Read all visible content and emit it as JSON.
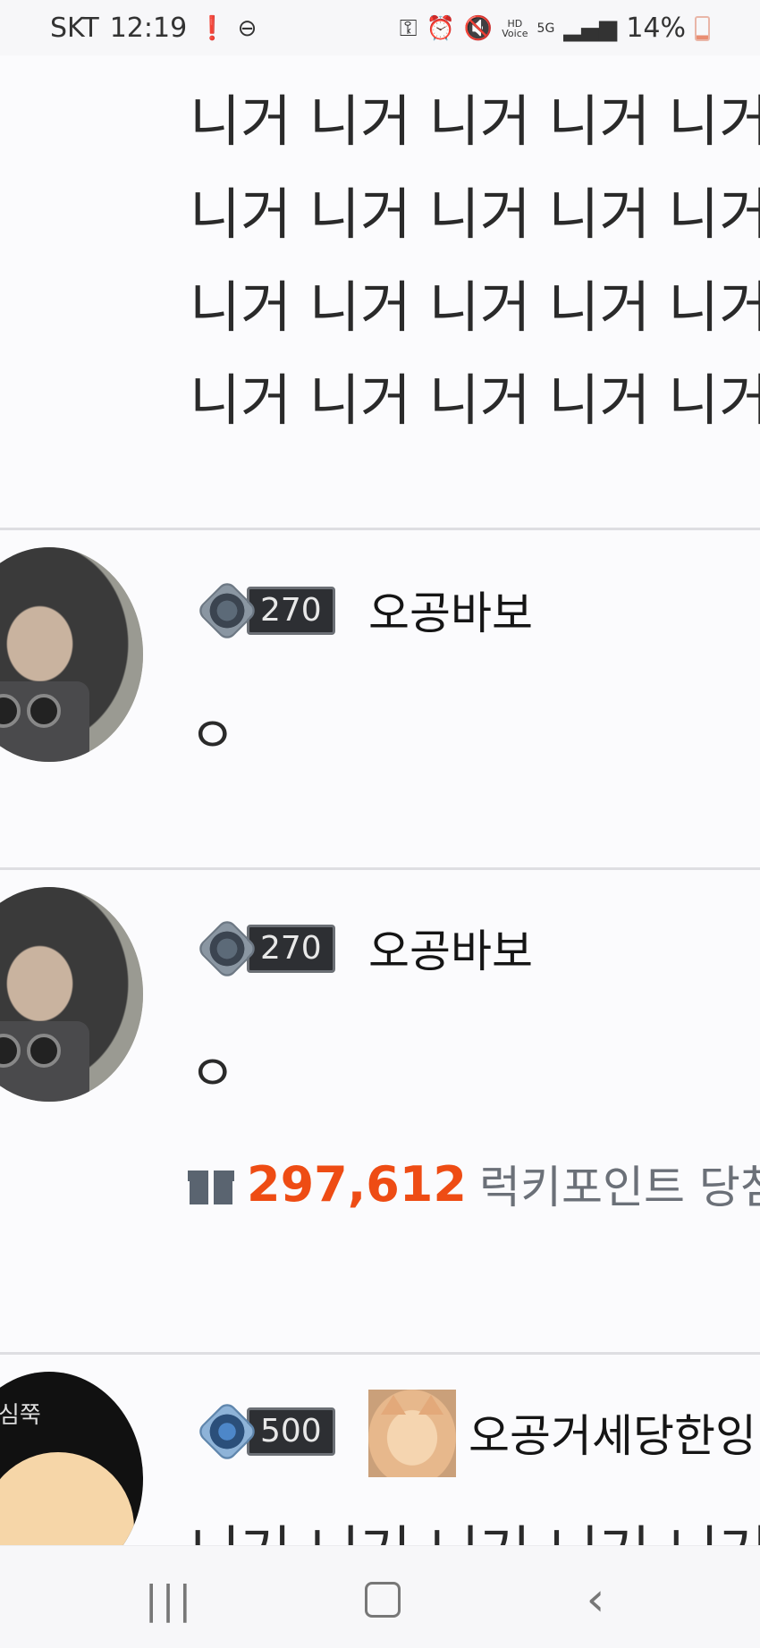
{
  "status_bar": {
    "carrier": "SKT",
    "time": "12:19",
    "battery_percent": "14%",
    "icons": [
      "alert-icon",
      "do-not-disturb-icon",
      "key-icon",
      "alarm-icon",
      "mute-icon",
      "hd-voice-icon",
      "5g-icon",
      "signal-icon",
      "battery-icon"
    ],
    "hd_label": "HD",
    "hd_sub": "Voice",
    "network": "5G"
  },
  "post": {
    "lines": [
      "니거 니거 니거 니거 니거 니거",
      "니거 니거 니거 니거 니거 니거",
      "니거 니거 니거 니거 니거 니거",
      "니거 니거 니거 니거 니거"
    ]
  },
  "comments": [
    {
      "rank": "270",
      "nickname": "오공바보",
      "text": "ㅇ"
    },
    {
      "rank": "270",
      "nickname": "오공바보",
      "text": "ㅇ",
      "lucky_points": "297,612",
      "lucky_label": "럭키포인트 당첨"
    },
    {
      "rank": "500",
      "nickname": "오공거세당한잉",
      "avatar_text": "심쭉",
      "text": "니거 니거 니거 니거 니거 니거"
    }
  ],
  "nav": {
    "recents": "|||",
    "back": "‹"
  },
  "colors": {
    "lucky": "#ee4c14",
    "divider": "#dedee2",
    "background": "#fbfbfd"
  }
}
